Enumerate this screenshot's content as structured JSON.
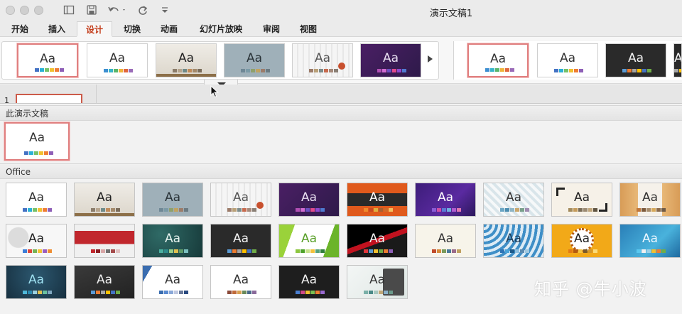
{
  "window": {
    "title": "演示文稿1"
  },
  "tabs": [
    "开始",
    "插入",
    "设计",
    "切换",
    "动画",
    "幻灯片放映",
    "审阅",
    "视图"
  ],
  "active_tab": "设计",
  "slide_number": "1",
  "sections": {
    "current": "此演示文稿",
    "office": "Office"
  },
  "thumb_text": "Aa",
  "watermark": "知乎 @牛小波",
  "colors": {
    "accent": "#c43e1c",
    "selection": "#e07f7f"
  },
  "icons": [
    "sidebar-toggle-icon",
    "save-icon",
    "undo-icon",
    "redo-icon",
    "customize-toolbar-icon",
    "scroll-right-icon",
    "expand-gallery-icon"
  ]
}
